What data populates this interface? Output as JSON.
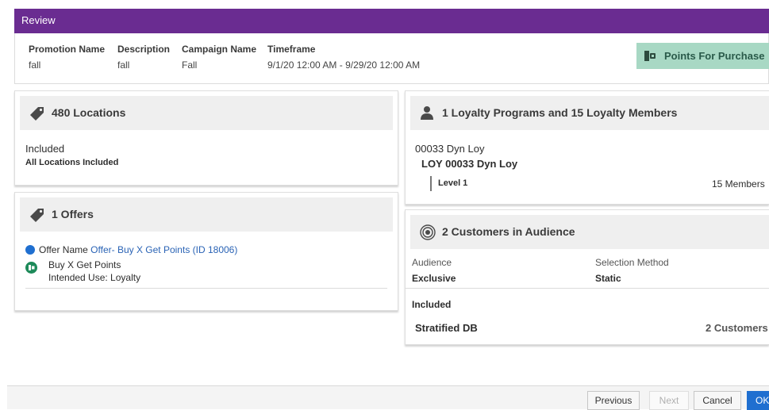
{
  "review": {
    "title": "Review"
  },
  "summary": {
    "promotion_name": {
      "label": "Promotion Name",
      "value": "fall"
    },
    "description": {
      "label": "Description",
      "value": "fall"
    },
    "campaign_name": {
      "label": "Campaign Name",
      "value": "Fall"
    },
    "timeframe": {
      "label": "Timeframe",
      "value": "9/1/20 12:00 AM - 9/29/20 12:00 AM"
    },
    "type_button": "Points For Purchase"
  },
  "locations": {
    "title": "480 Locations",
    "status": "Included",
    "detail": "All Locations Included"
  },
  "offers": {
    "title": "1 Offers",
    "offer_label": "Offer Name",
    "offer_link": "Offer- Buy X Get Points (ID 18006)",
    "offer_type": "Buy X Get Points",
    "intended_use": "Intended Use: Loyalty"
  },
  "loyalty": {
    "title": "1 Loyalty Programs and 15 Loyalty Members",
    "program_code": "00033 Dyn Loy",
    "program_name": "LOY 00033 Dyn Loy",
    "level": "Level 1",
    "members": "15 Members"
  },
  "audience": {
    "title": "2 Customers in Audience",
    "audience_label": "Audience",
    "audience_value": "Exclusive",
    "selection_label": "Selection Method",
    "selection_value": "Static",
    "included_label": "Included",
    "segment_name": "Stratified DB",
    "segment_count": "2 Customers"
  },
  "footer": {
    "previous": "Previous",
    "next": "Next",
    "cancel": "Cancel",
    "ok": "OK"
  },
  "colors": {
    "header_purple": "#6a2c91",
    "type_button_bg": "#a8d8c4",
    "link_blue": "#2a63b5",
    "ok_blue": "#1f6fd0",
    "offer_icon_green": "#1e8a5a"
  }
}
